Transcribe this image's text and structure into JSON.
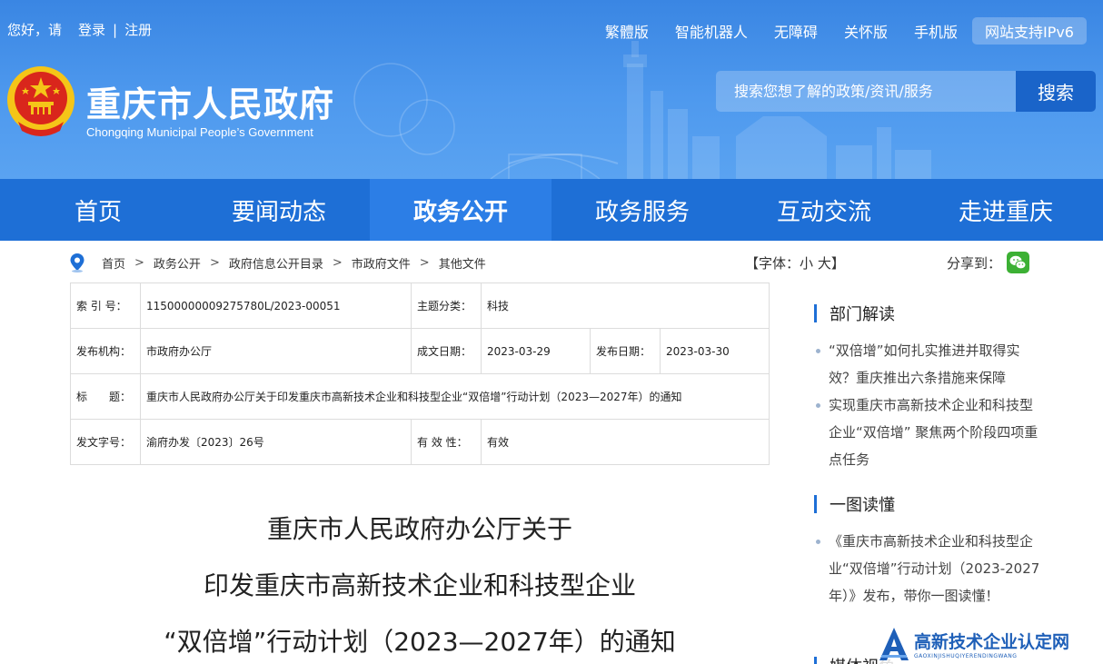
{
  "header": {
    "greeting": "您好，请",
    "login": "登录",
    "divider": "|",
    "register": "注册",
    "top_links": [
      "繁體版",
      "智能机器人",
      "无障碍",
      "关怀版",
      "手机版"
    ],
    "ipv6": "网站支持IPv6",
    "site_title": "重庆市人民政府",
    "site_subtitle": "Chongqing Municipal People’s Government",
    "search_placeholder": "搜索您想了解的政策/资讯/服务",
    "search_button": "搜索"
  },
  "nav": {
    "items": [
      "首页",
      "要闻动态",
      "政务公开",
      "政务服务",
      "互动交流",
      "走进重庆"
    ],
    "active_index": 2
  },
  "breadcrumb": {
    "items": [
      "首页",
      "政务公开",
      "政府信息公开目录",
      "市政府文件",
      "其他文件"
    ],
    "sep": ">"
  },
  "font_size": {
    "open": "【字体：",
    "small": "小",
    "large": "大",
    "close": "】"
  },
  "share": {
    "label": "分享到：",
    "icon": "wechat-icon"
  },
  "info_table": {
    "index_label": "索 引 号：",
    "index_value": "11500000009275780L/2023-00051",
    "topic_label": "主题分类：",
    "topic_value": "科技",
    "issuer_label": "发布机构：",
    "issuer_value": "市政府办公厅",
    "created_label": "成文日期：",
    "created_value": "2023-03-29",
    "published_label": "发布日期：",
    "published_value": "2023-03-30",
    "title_label": "标　　题：",
    "title_value": "重庆市人民政府办公厅关于印发重庆市高新技术企业和科技型企业“双倍增”行动计划（2023—2027年）的通知",
    "doc_no_label": "发文字号：",
    "doc_no_value": "渝府办发〔2023〕26号",
    "validity_label": "有 效 性：",
    "validity_value": "有效"
  },
  "article": {
    "title_lines": [
      "重庆市人民政府办公厅关于",
      "印发重庆市高新技术企业和科技型企业",
      "“双倍增”行动计划（2023—2027年）的通知"
    ]
  },
  "sidebar": {
    "sections": [
      {
        "title": "部门解读",
        "items": [
          "“双倍增”如何扎实推进并取得实效？重庆推出六条措施来保障",
          "实现重庆市高新技术企业和科技型企业“双倍增” 聚焦两个阶段四项重点任务"
        ]
      },
      {
        "title": "一图读懂",
        "items": [
          "《重庆市高新技术企业和科技型企业“双倍增”行动计划（2023-2027年）》发布，带你一图读懂！"
        ]
      },
      {
        "title": "媒体视角",
        "items": []
      }
    ]
  },
  "watermark": {
    "title": "高新技术企业认定网",
    "pinyin": "GAOXINJISHUQIYERENDINGWANG"
  },
  "colors": {
    "header_blue": "#4a95ea",
    "nav_blue": "#1e6fd6",
    "nav_active": "#2c7ee6",
    "search_button": "#1a64c9",
    "emblem_red": "#d9261c",
    "emblem_gold": "#f5c518",
    "wechat_green": "#3cb034"
  }
}
